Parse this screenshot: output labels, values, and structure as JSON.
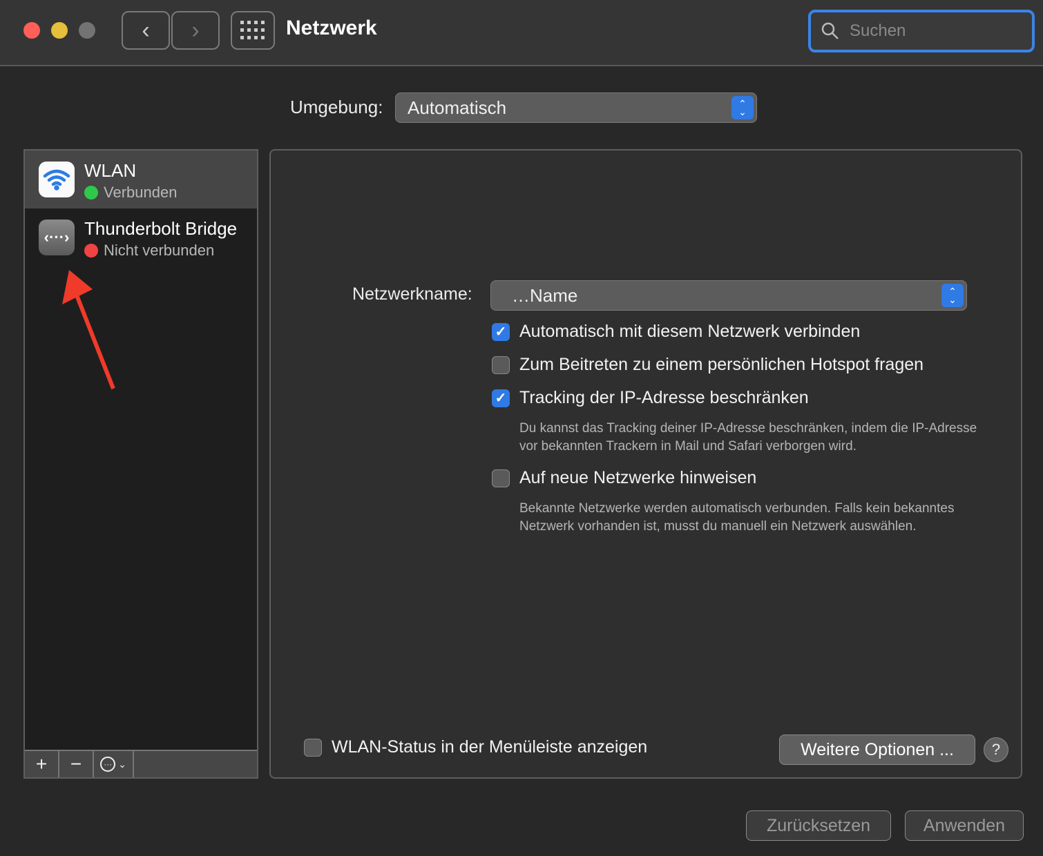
{
  "window": {
    "title": "Netzwerk",
    "search_placeholder": "Suchen"
  },
  "location": {
    "label": "Umgebung:",
    "value": "Automatisch"
  },
  "services": [
    {
      "name": "WLAN",
      "status": "Verbunden",
      "status_color": "#30c84a"
    },
    {
      "name": "Thunderbolt Bridge",
      "status": "Nicht verbunden",
      "status_color": "#f04444"
    }
  ],
  "sidebar_toolbar": {
    "add": "+",
    "remove": "−"
  },
  "panel": {
    "network_name_label": "Netzwerkname:",
    "network_name_value": "…Name",
    "options": [
      {
        "label": "Automatisch mit diesem Netzwerk verbinden",
        "checked": true
      },
      {
        "label": "Zum Beitreten zu einem persönlichen Hotspot fragen",
        "checked": false
      },
      {
        "label": "Tracking der IP-Adresse beschränken",
        "checked": true,
        "help": "Du kannst das Tracking deiner IP-Adresse beschränken, indem die IP-Adresse vor bekannten Trackern in Mail und Safari verborgen wird."
      },
      {
        "label": "Auf neue Netzwerke hinweisen",
        "checked": false,
        "help": "Bekannte Netzwerke werden automatisch verbunden. Falls kein bekanntes Netzwerk vorhanden ist, musst du manuell ein Netzwerk auswählen."
      }
    ],
    "menubar_status_label": "WLAN-Status in der Menüleiste anzeigen",
    "more_options": "Weitere Optionen ...",
    "help": "?"
  },
  "footer": {
    "revert": "Zurücksetzen",
    "apply": "Anwenden"
  }
}
